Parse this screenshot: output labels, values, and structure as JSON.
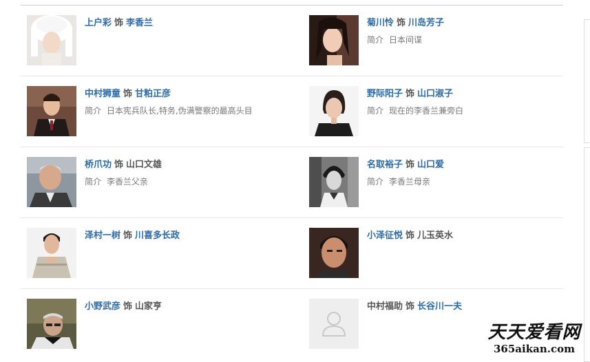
{
  "separator_word": "饰",
  "intro_label": "简介",
  "cast": [
    {
      "actor": "上户彩",
      "role": "李香兰",
      "intro": ""
    },
    {
      "actor": "菊川怜",
      "role": "川岛芳子",
      "intro": "日本间谍"
    },
    {
      "actor": "中村狮童",
      "role": "甘粕正彦",
      "intro": "日本宪兵队长,特务,伪满警察的最高头目"
    },
    {
      "actor": "野际阳子",
      "role": "山口淑子",
      "intro": "现在的李香兰兼旁白"
    },
    {
      "actor": "桥爪功",
      "role": "山口文雄",
      "intro": "李香兰父亲"
    },
    {
      "actor": "名取裕子",
      "role": "山口爱",
      "intro": "李香兰母亲"
    },
    {
      "actor": "泽村一树",
      "role": "川喜多长政",
      "intro": ""
    },
    {
      "actor": "小泽征悦",
      "role": "儿玉英水",
      "intro": ""
    },
    {
      "actor": "小野武彦",
      "role": "山家亨",
      "intro": ""
    },
    {
      "actor": "中村福助",
      "role": "长谷川一夫",
      "intro": ""
    }
  ],
  "watermark": {
    "name": "天天爱看网",
    "url": "365aikan.com"
  },
  "colors": {
    "link": "#2c6aa5",
    "text": "#555555",
    "muted": "#777777",
    "divider": "#e6e6e6"
  }
}
